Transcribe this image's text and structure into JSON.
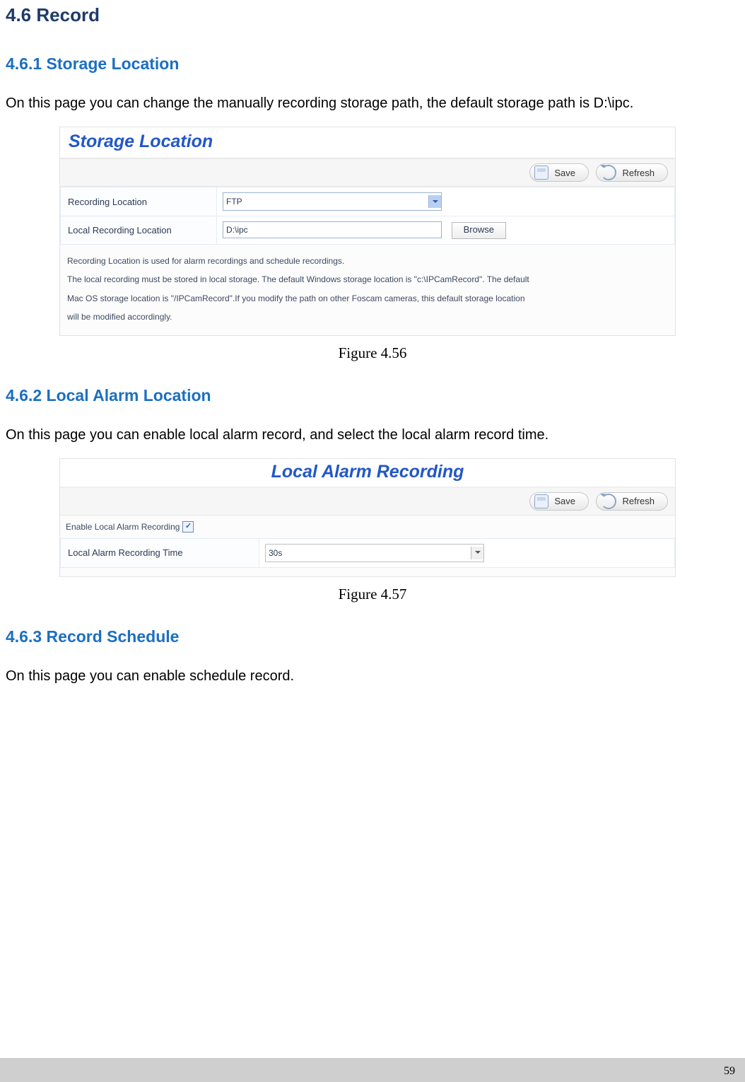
{
  "headings": {
    "h46": "4.6 Record",
    "h461": "4.6.1 Storage Location",
    "h462": "4.6.2 Local Alarm Location",
    "h463": "4.6.3 Record Schedule"
  },
  "paragraphs": {
    "p461": "On this page you can change the manually recording storage path, the default storage path is D:\\ipc.",
    "p462": "On this page you can enable local alarm record, and select the local alarm record time.",
    "p463": "On this page you can enable schedule record."
  },
  "figcaps": {
    "f56": "Figure 4.56",
    "f57": "Figure 4.57"
  },
  "storage_panel": {
    "title": "Storage Location",
    "save": "Save",
    "refresh": "Refresh",
    "rows": {
      "rec_loc_label": "Recording Location",
      "rec_loc_value": "FTP",
      "local_loc_label": "Local Recording Location",
      "local_loc_value": "D:\\ipc",
      "browse": "Browse"
    },
    "notes": {
      "n1": "Recording Location is used for alarm recordings and schedule recordings.",
      "n2": "The local recording must be stored in local storage. The default Windows storage location is \"c:\\IPCamRecord\". The default",
      "n3": "Mac OS storage location is \"/IPCamRecord\".If you modify the path on other Foscam cameras, this default storage location",
      "n4": "will be modified accordingly."
    }
  },
  "alarm_panel": {
    "title": "Local Alarm Recording",
    "save": "Save",
    "refresh": "Refresh",
    "enable_label": "Enable Local Alarm Recording",
    "time_label": "Local Alarm Recording Time",
    "time_value": "30s"
  },
  "page_number": "59"
}
